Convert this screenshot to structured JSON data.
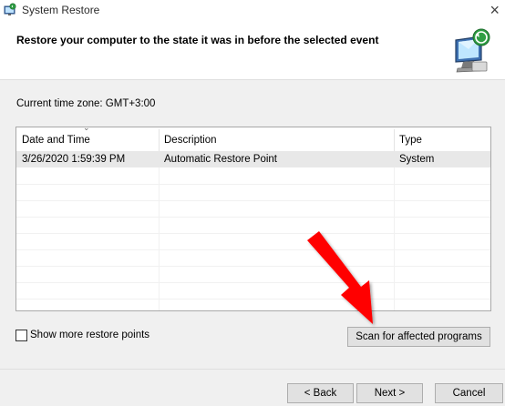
{
  "window": {
    "title": "System Restore",
    "close_glyph": "×"
  },
  "header": {
    "heading": "Restore your computer to the state it was in before the selected event",
    "icon": "system-restore-monitor-icon"
  },
  "timezone": {
    "label": "Current time zone: GMT+3:00"
  },
  "list": {
    "columns": [
      "Date and Time",
      "Description",
      "Type"
    ],
    "sorted_column": "Date and Time",
    "rows": [
      {
        "date": "3/26/2020 1:59:39 PM",
        "description": "Automatic Restore Point",
        "type": "System",
        "selected": true
      }
    ]
  },
  "checkbox": {
    "label": "Show more restore points",
    "checked": false
  },
  "buttons": {
    "scan": "Scan for affected programs",
    "back": "< Back",
    "next": "Next >",
    "cancel": "Cancel"
  },
  "annotation": {
    "arrow_color": "#ff0000",
    "target": "Scan for affected programs"
  }
}
